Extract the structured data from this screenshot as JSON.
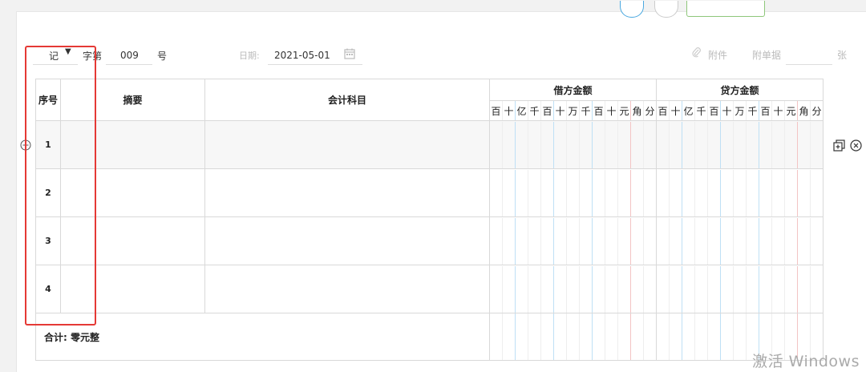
{
  "voucher": {
    "type_value": "记",
    "zi_label": "字第",
    "number_value": "009",
    "hao_label": "号",
    "date_label": "日期:",
    "date_value": "2021-05-01",
    "attachment_label": "附件",
    "docs_label": "附单据",
    "docs_unit": "张"
  },
  "table": {
    "headers": {
      "seq": "序号",
      "summary": "摘要",
      "account": "会计科目",
      "debit": "借方金额",
      "credit": "贷方金额"
    },
    "digit_labels": [
      "百",
      "十",
      "亿",
      "千",
      "百",
      "十",
      "万",
      "千",
      "百",
      "十",
      "元",
      "角",
      "分"
    ],
    "rows": [
      {
        "num": "1"
      },
      {
        "num": "2"
      },
      {
        "num": "3"
      },
      {
        "num": "4"
      }
    ],
    "total_label": "合计:",
    "total_value": "零元整"
  },
  "watermark": "激活 Windows",
  "colors": {
    "highlight_box": "#e53935",
    "digit_divider_blue": "#bfe0f5",
    "digit_divider_red": "#f3c4c4"
  }
}
